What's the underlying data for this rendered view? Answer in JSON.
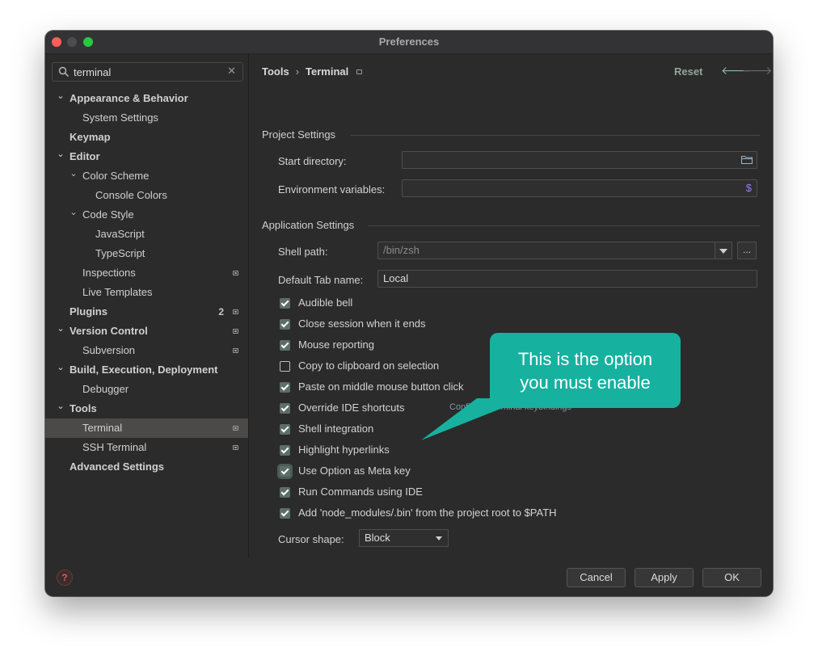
{
  "window": {
    "title": "Preferences"
  },
  "search": {
    "value": "terminal",
    "clear": "✕"
  },
  "sidebar": {
    "items": [
      {
        "label": "Appearance & Behavior",
        "level": 0,
        "expanded": true,
        "bold": true
      },
      {
        "label": "System Settings",
        "level": 1
      },
      {
        "label": "Keymap",
        "level": 0,
        "bold": true
      },
      {
        "label": "Editor",
        "level": 0,
        "expanded": true,
        "bold": true
      },
      {
        "label": "Color Scheme",
        "level": 1,
        "expanded": true
      },
      {
        "label": "Console Colors",
        "level": 2
      },
      {
        "label": "Code Style",
        "level": 1,
        "expanded": true
      },
      {
        "label": "JavaScript",
        "level": 2
      },
      {
        "label": "TypeScript",
        "level": 2
      },
      {
        "label": "Inspections",
        "level": 1,
        "badge": true
      },
      {
        "label": "Live Templates",
        "level": 1
      },
      {
        "label": "Plugins",
        "level": 0,
        "bold": true,
        "badge": true,
        "count": "2"
      },
      {
        "label": "Version Control",
        "level": 0,
        "expanded": true,
        "bold": true,
        "badge": true
      },
      {
        "label": "Subversion",
        "level": 1,
        "badge": true
      },
      {
        "label": "Build, Execution, Deployment",
        "level": 0,
        "expanded": true,
        "bold": true
      },
      {
        "label": "Debugger",
        "level": 1
      },
      {
        "label": "Tools",
        "level": 0,
        "expanded": true,
        "bold": true
      },
      {
        "label": "Terminal",
        "level": 1,
        "badge": true,
        "selected": true
      },
      {
        "label": "SSH Terminal",
        "level": 1,
        "badge": true
      },
      {
        "label": "Advanced Settings",
        "level": 0,
        "bold": true
      }
    ]
  },
  "header": {
    "crumb_parent": "Tools",
    "crumb_sep": "›",
    "crumb_current": "Terminal",
    "reset": "Reset",
    "back": "🡐",
    "forward": "🡒"
  },
  "project_settings": {
    "title": "Project Settings",
    "start_directory_label": "Start directory:",
    "start_directory_value": "",
    "env_vars_label": "Environment variables:",
    "env_vars_value": "",
    "env_icon": "$"
  },
  "app_settings": {
    "title": "Application Settings",
    "shell_path_label": "Shell path:",
    "shell_path_value": "/bin/zsh",
    "browse": "...",
    "default_tab_label": "Default Tab name:",
    "default_tab_value": "Local"
  },
  "checkboxes": [
    {
      "label": "Audible bell",
      "checked": true
    },
    {
      "label": "Close session when it ends",
      "checked": true
    },
    {
      "label": "Mouse reporting",
      "checked": true
    },
    {
      "label": "Copy to clipboard on selection",
      "checked": false
    },
    {
      "label": "Paste on middle mouse button click",
      "checked": true
    },
    {
      "label": "Override IDE shortcuts",
      "checked": true,
      "link": "Configure terminal keybindings"
    },
    {
      "label": "Shell integration",
      "checked": true
    },
    {
      "label": "Highlight hyperlinks",
      "checked": true
    },
    {
      "label": "Use Option as Meta key",
      "checked": true,
      "focused": true
    },
    {
      "label": "Run Commands using IDE",
      "checked": true
    },
    {
      "label": "Add 'node_modules/.bin' from the project root to $PATH",
      "checked": true
    }
  ],
  "cursor": {
    "label": "Cursor shape:",
    "value": "Block"
  },
  "footer": {
    "help": "?",
    "cancel": "Cancel",
    "apply": "Apply",
    "ok": "OK"
  },
  "callout": {
    "line1": "This is the option",
    "line2": "you must enable"
  },
  "colors": {
    "callout": "#17b1a0",
    "accent": "#5d6e68",
    "help": "#e05a5a"
  }
}
